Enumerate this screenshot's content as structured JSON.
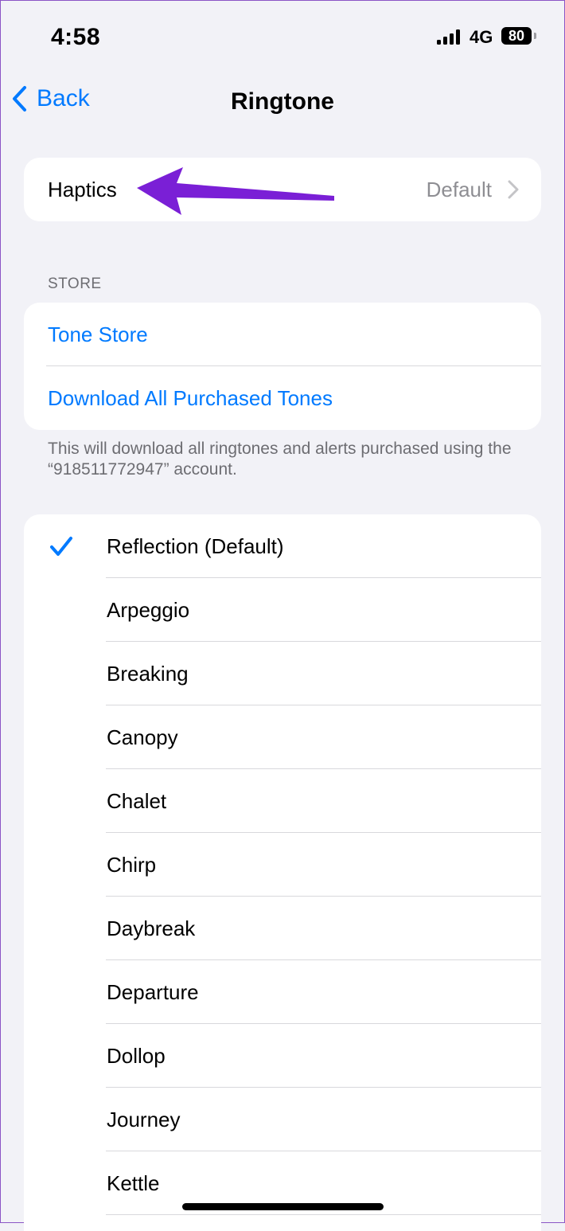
{
  "status_bar": {
    "time": "4:58",
    "network": "4G",
    "battery": "80"
  },
  "nav": {
    "back_label": "Back",
    "title": "Ringtone"
  },
  "haptics": {
    "label": "Haptics",
    "value": "Default"
  },
  "store": {
    "header": "STORE",
    "items": [
      {
        "label": "Tone Store"
      },
      {
        "label": "Download All Purchased Tones"
      }
    ],
    "footer": "This will download all ringtones and alerts purchased using the “918511772947” account."
  },
  "ringtones": {
    "selected_index": 0,
    "items": [
      {
        "label": "Reflection (Default)"
      },
      {
        "label": "Arpeggio"
      },
      {
        "label": "Breaking"
      },
      {
        "label": "Canopy"
      },
      {
        "label": "Chalet"
      },
      {
        "label": "Chirp"
      },
      {
        "label": "Daybreak"
      },
      {
        "label": "Departure"
      },
      {
        "label": "Dollop"
      },
      {
        "label": "Journey"
      },
      {
        "label": "Kettle"
      }
    ]
  },
  "colors": {
    "accent": "#007aff",
    "annotation_arrow": "#7a1fd6",
    "background": "#f2f2f7"
  }
}
